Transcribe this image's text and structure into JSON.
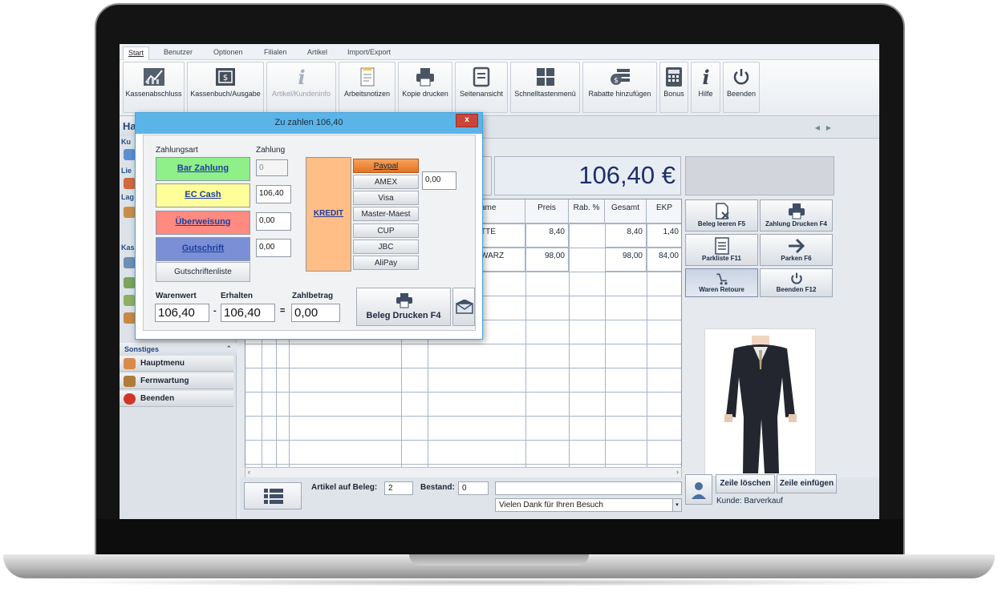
{
  "ribbon": {
    "tabs": [
      "Start",
      "Benutzer",
      "Optionen",
      "Filialen",
      "Artikel",
      "Import/Export"
    ],
    "buttons": [
      "Kassenabschluss",
      "Kassenbuch/Ausgabe",
      "Artikel/Kundeninfo",
      "Arbeitsnotizen",
      "Kopie drucken",
      "Seitenansicht",
      "Schnelltastenmenü",
      "Rabatte hinzufügen",
      "Bonus",
      "Hilfe",
      "Beenden"
    ]
  },
  "sidebar": {
    "partial_title": "Ha",
    "partial_labels": [
      "Ku",
      "Lie",
      "Lag",
      "Kas"
    ],
    "section_title": "Sonstiges",
    "items": [
      "Hauptmenu",
      "Fernwartung",
      "Beenden"
    ]
  },
  "main": {
    "total": "106,40 €",
    "columns": [
      "ame",
      "Preis",
      "Rab. %",
      "Gesamt",
      "EKP"
    ],
    "rows": [
      {
        "name": "TTE",
        "preis": "8,40",
        "rabatt": "",
        "gesamt": "8,40",
        "ekp": "1,40"
      },
      {
        "name": "WARZ",
        "preis": "98,00",
        "rabatt": "",
        "gesamt": "98,00",
        "ekp": "84,00"
      }
    ],
    "artikel_label": "Artikel auf Beleg:",
    "artikel_value": "2",
    "bestand_label": "Bestand:",
    "bestand_value": "0",
    "message": "Vielen Dank für Ihren Besuch"
  },
  "right_panel": {
    "buttons": [
      "Beleg leeren F5",
      "Zahlung Drucken F4",
      "Parkliste F11",
      "Parken F6",
      "Waren Retoure",
      "Beenden  F12"
    ],
    "delete_line": "Zeile löschen",
    "insert_line": "Zeile einfügen",
    "customer": "Kunde: Barverkauf"
  },
  "dialog": {
    "title": "Zu zahlen 106,40",
    "close_label": "x",
    "zahlungsart_label": "Zahlungsart",
    "zahlung_label": "Zahlung",
    "methods": [
      {
        "label": "Bar Zahlung",
        "value": "0",
        "color": "#8ff08a"
      },
      {
        "label": "EC Cash",
        "value": "106,40",
        "color": "#ffff99"
      },
      {
        "label": "Überweisung",
        "value": "0,00",
        "color": "#ff8a80"
      },
      {
        "label": "Gutschrift",
        "value": "0,00",
        "color": "#7b8fd6"
      }
    ],
    "gutschriften_label": "Gutschriftenliste",
    "kredit_label": "KREDIT",
    "cards": [
      "Paypal",
      "AMEX",
      "Visa",
      "Master-Maest",
      "CUP",
      "JBC",
      "AliPay"
    ],
    "card_value": "0,00",
    "warenwert_label": "Warenwert",
    "erhalten_label": "Erhalten",
    "zahlbetrag_label": "Zahlbetrag",
    "warenwert": "106,40",
    "erhalten": "106,40",
    "zahlbetrag": "0,00",
    "minus": "-",
    "equals": "=",
    "print_label": "Beleg Drucken     F4"
  }
}
